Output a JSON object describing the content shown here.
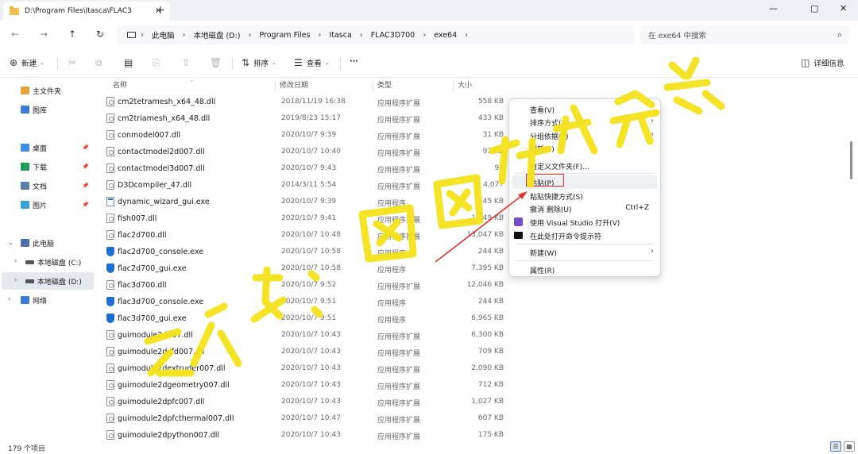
{
  "window": {
    "tab_title": "D:\\Program Files\\Itasca\\FLAC3",
    "tab_close": "✕",
    "new_tab": "+",
    "controls": [
      "—",
      "▢",
      "✕"
    ]
  },
  "address": {
    "back": "←",
    "forward": "→",
    "up": "↑",
    "refresh": "↻",
    "breadcrumbs": [
      "此电脑",
      "本地磁盘 (D:)",
      "Program Files",
      "Itasca",
      "FLAC3D700",
      "exe64"
    ],
    "separator": "›",
    "search_placeholder": "在 exe64 中搜索",
    "search_icon": "⌕"
  },
  "toolbar": {
    "new_label": "新建",
    "sort_label": "排序",
    "view_label": "查看",
    "more_label": "···",
    "details_label": "详细信息"
  },
  "sidebar": {
    "items": [
      {
        "label": "主文件夹",
        "icon": "home-icon",
        "color": "#e9a33b"
      },
      {
        "label": "图库",
        "icon": "gallery-icon",
        "color": "#3a7bd5"
      },
      {
        "label": "桌面",
        "icon": "desktop-icon",
        "color": "#3a8ee6"
      },
      {
        "label": "下载",
        "icon": "download-icon",
        "color": "#1f9e5a"
      },
      {
        "label": "文档",
        "icon": "documents-icon",
        "color": "#5b7fa8"
      },
      {
        "label": "图片",
        "icon": "pictures-icon",
        "color": "#3aa0d8"
      },
      {
        "label": "此电脑",
        "icon": "computer-icon",
        "color": "#4b6fa8"
      },
      {
        "label": "本地磁盘 (C:)",
        "icon": "drive-icon",
        "color": "#555555"
      },
      {
        "label": "本地磁盘 (D:)",
        "icon": "drive-icon",
        "color": "#555555"
      },
      {
        "label": "网络",
        "icon": "network-icon",
        "color": "#3a7bd5"
      }
    ]
  },
  "columns": {
    "name": "名称",
    "date": "修改日期",
    "type": "类型",
    "size": "大小"
  },
  "files": [
    {
      "name": "cm2tetramesh_x64_48.dll",
      "date": "2018/11/19 16:38",
      "type": "应用程序扩展",
      "size": "558 KB",
      "kind": "dll"
    },
    {
      "name": "cm2triamesh_x64_48.dll",
      "date": "2019/8/23 15:17",
      "type": "应用程序扩展",
      "size": "433 KB",
      "kind": "dll"
    },
    {
      "name": "conmodel007.dll",
      "date": "2020/10/7 9:39",
      "type": "应用程序扩展",
      "size": "31 KB",
      "kind": "dll"
    },
    {
      "name": "contactmodel2d007.dll",
      "date": "2020/10/7 10:40",
      "type": "应用程序扩展",
      "size": "93 KB",
      "kind": "dll"
    },
    {
      "name": "contactmodel3d007.dll",
      "date": "2020/10/7 9:43",
      "type": "应用程序扩展",
      "size": "92",
      "kind": "dll"
    },
    {
      "name": "D3Dcompiler_47.dll",
      "date": "2014/3/11 5:54",
      "type": "应用程序扩展",
      "size": "4,077",
      "kind": "dll"
    },
    {
      "name": "dynamic_wizard_gui.exe",
      "date": "2020/10/7 9:39",
      "type": "应用程序",
      "size": "345 KB",
      "kind": "app"
    },
    {
      "name": "fish007.dll",
      "date": "2020/10/7 9:41",
      "type": "应用程序扩展",
      "size": "1,949 KB",
      "kind": "dll"
    },
    {
      "name": "flac2d700.dll",
      "date": "2020/10/7 10:48",
      "type": "应用程序扩展",
      "size": "13,047 KB",
      "kind": "dll"
    },
    {
      "name": "flac2d700_console.exe",
      "date": "2020/10/7 10:58",
      "type": "应用程序",
      "size": "244 KB",
      "kind": "exe"
    },
    {
      "name": "flac2d700_gui.exe",
      "date": "2020/10/7 10:58",
      "type": "应用程序",
      "size": "7,395 KB",
      "kind": "exe"
    },
    {
      "name": "flac3d700.dll",
      "date": "2020/10/7 9:52",
      "type": "应用程序扩展",
      "size": "12,046 KB",
      "kind": "dll"
    },
    {
      "name": "flac3d700_console.exe",
      "date": "2020/10/7 9:51",
      "type": "应用程序",
      "size": "244 KB",
      "kind": "exe"
    },
    {
      "name": "flac3d700_gui.exe",
      "date": "2020/10/7 9:51",
      "type": "应用程序",
      "size": "6,965 KB",
      "kind": "exe"
    },
    {
      "name": "guimodule2d007.dll",
      "date": "2020/10/7 10:43",
      "type": "应用程序扩展",
      "size": "6,300 KB",
      "kind": "dll"
    },
    {
      "name": "guimodule2dcfd007.dll",
      "date": "2020/10/7 10:43",
      "type": "应用程序扩展",
      "size": "709 KB",
      "kind": "dll"
    },
    {
      "name": "guimodule2dextruder007.dll",
      "date": "2020/10/7 10:43",
      "type": "应用程序扩展",
      "size": "2,090 KB",
      "kind": "dll"
    },
    {
      "name": "guimodule2dgeometry007.dll",
      "date": "2020/10/7 10:43",
      "type": "应用程序扩展",
      "size": "712 KB",
      "kind": "dll"
    },
    {
      "name": "guimodule2dpfc007.dll",
      "date": "2020/10/7 10:43",
      "type": "应用程序扩展",
      "size": "1,027 KB",
      "kind": "dll"
    },
    {
      "name": "guimodule2dpfcthermal007.dll",
      "date": "2020/10/7 10:47",
      "type": "应用程序扩展",
      "size": "607 KB",
      "kind": "dll"
    },
    {
      "name": "guimodule2dpython007.dll",
      "date": "2020/10/7 10:43",
      "type": "应用程序扩展",
      "size": "175 KB",
      "kind": "dll"
    }
  ],
  "status": {
    "count": "179 个项目"
  },
  "context_menu": {
    "view": "查看(V)",
    "sort_by": "排序方式(O)",
    "group_by": "分组依据(P)",
    "refresh": "刷新(E)",
    "customize": "自定义文件夹(F)...",
    "paste": "粘贴(P)",
    "paste_shortcut": "粘贴快捷方式(S)",
    "undo_delete": "撤消 删除(U)",
    "undo_shortcut": "Ctrl+Z",
    "open_vs": "使用 Visual Studio 打开(V)",
    "open_cmd": "在此处打开命令提示符",
    "new": "新建(W)",
    "properties": "属性(R)",
    "submenu_arrow": "›"
  },
  "watermark": {
    "text": "公众号：图图软件安装",
    "color": "#f5e21b"
  },
  "colors": {
    "annotation_red": "#e0312f",
    "selection": "#e5e8ee"
  }
}
